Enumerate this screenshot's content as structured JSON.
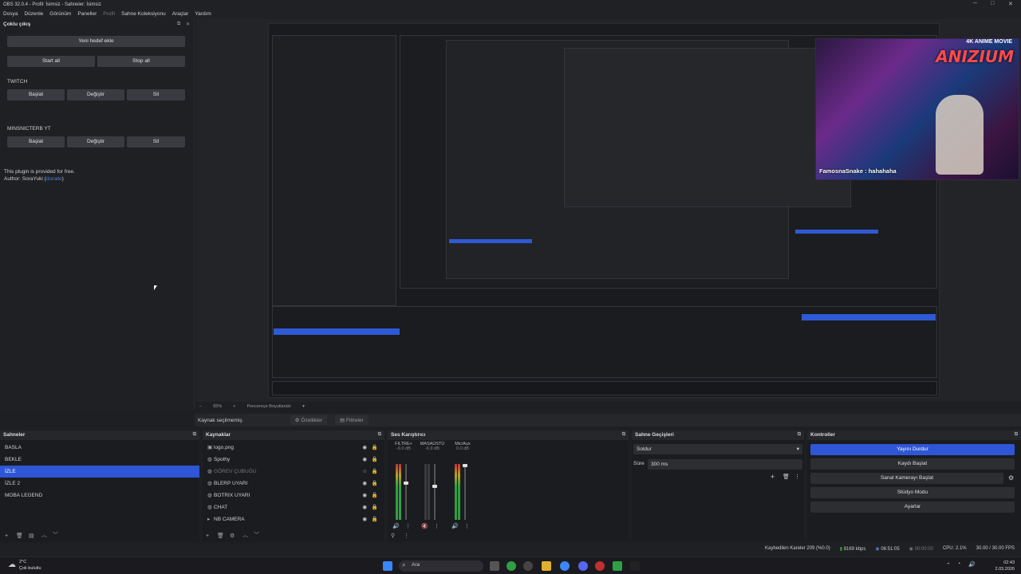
{
  "window": {
    "title": "OBS 32.0.4 - Profil: İsimsiz - Sahneler: İsimsiz"
  },
  "menu": {
    "items": [
      "Dosya",
      "Düzenle",
      "Görünüm",
      "Paneller",
      "Profil",
      "Sahne Koleksiyonu",
      "Araçlar",
      "Yardım"
    ]
  },
  "dock": {
    "title": "Çoklu çıkış",
    "add_target": "Yeni hedef ekle",
    "start_all": "Start all",
    "stop_all": "Stop all",
    "targets": [
      {
        "name": "TWITCH",
        "start": "Başlat",
        "edit": "Değiştir",
        "delete": "Sil"
      },
      {
        "name": "MINSNICTERB YT",
        "start": "Başlat",
        "edit": "Değiştir",
        "delete": "Sil"
      }
    ],
    "free_note": "This plugin is provided for free.",
    "author_prefix": "Author: SoraYuki (",
    "author_link": "donate",
    "author_suffix": ")"
  },
  "camera": {
    "brand": "ANIZIUM",
    "brand_tag": "4K ANIME MOVIE",
    "chat": "FamosnaSnake : hahahaha"
  },
  "zoom": {
    "level": "65%",
    "mode": "Pencereye Boyutlandır"
  },
  "context": {
    "no_source": "Kaynak seçilmemiş",
    "properties": "Özellikler",
    "filters": "Filtreler"
  },
  "scenes": {
    "title": "Sahneler",
    "items": [
      "BASLA",
      "BEKLE",
      "İZLE",
      "İZLE 2",
      "MOBA LEGEND"
    ],
    "selected_index": 2
  },
  "sources": {
    "title": "Kaynaklar",
    "items": [
      {
        "name": "logo.png",
        "icon": "image-icon",
        "hidden": false
      },
      {
        "name": "Spothy",
        "icon": "globe-icon",
        "hidden": false
      },
      {
        "name": "GÖREV ÇUBUĞU",
        "icon": "globe-icon",
        "hidden": true
      },
      {
        "name": "BLERP UYARI",
        "icon": "globe-icon",
        "hidden": false
      },
      {
        "name": "BOTRIX UYARI",
        "icon": "globe-icon",
        "hidden": false
      },
      {
        "name": "CHAT",
        "icon": "globe-icon",
        "hidden": false
      },
      {
        "name": "NB CAMERA",
        "icon": "camera-icon",
        "hidden": false
      }
    ]
  },
  "mixer": {
    "title": "Ses Karıştırıcı",
    "channels": [
      {
        "name": "FILTRE+",
        "db": "-6.0 dB"
      },
      {
        "name": "MASAÜSTÜ",
        "db": "-6.9 dB"
      },
      {
        "name": "Mic/Aux",
        "db": "0.0 dB"
      }
    ]
  },
  "transitions": {
    "title": "Sahne Geçişleri",
    "type": "Soldur",
    "duration_label": "Süre",
    "duration_value": "300 ms"
  },
  "controls": {
    "title": "Kontroller",
    "stop_stream": "Yayını Durdur",
    "start_recording": "Kaydı Başlat",
    "start_vcam": "Sanal Kamerayı Başlat",
    "studio_mode": "Stüdyo Modu",
    "settings": "Ayarlar"
  },
  "status": {
    "dropped": "Kaybedilen Kareler 209 (%0.0)",
    "bitrate": "8169 kbps",
    "stream_time": "06:51:05",
    "rec_time": "00:00:00",
    "cpu": "CPU: 2.1%",
    "fps": "30.00 / 30.00 FPS"
  },
  "taskbar": {
    "weather_temp": "2°C",
    "weather_desc": "Çok bulutlu",
    "search": "Ara",
    "time": "02:43",
    "date": "2.03.2026"
  }
}
